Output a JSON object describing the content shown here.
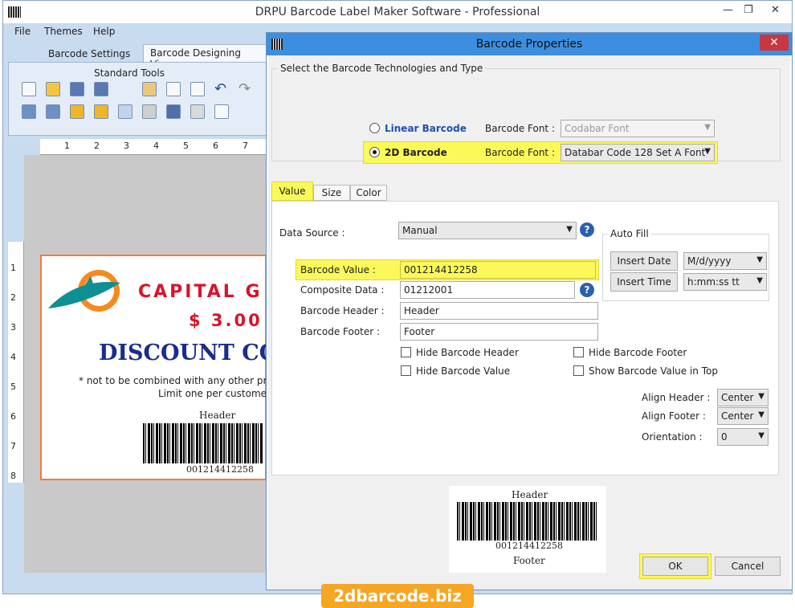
{
  "app": {
    "title": "DRPU Barcode Label Maker Software - Professional",
    "menu": [
      "File",
      "Themes",
      "Help"
    ],
    "ribbon_tabs": [
      "Barcode Settings",
      "Barcode Designing View"
    ],
    "ribbon_group": "Standard Tools",
    "ruler_h": [
      "1",
      "2",
      "3",
      "4",
      "5",
      "6",
      "7"
    ],
    "ruler_v": [
      "1",
      "2",
      "3",
      "4",
      "5",
      "6",
      "7",
      "8"
    ]
  },
  "label": {
    "line1": "CAPITAL G",
    "line2": "$ 3.00",
    "line3": "DISCOUNT CO",
    "fine1": "* not to be combined with any other pro",
    "fine2": "Limit one per customer",
    "header": "Header",
    "value": "001214412258"
  },
  "dialog": {
    "title": "Barcode Properties",
    "close": "✕",
    "tech_group": "Select the Barcode Technologies and Type",
    "linear": {
      "label": "Linear Barcode",
      "font_label": "Barcode Font :",
      "font": "Codabar Font"
    },
    "twod": {
      "label": "2D Barcode",
      "font_label": "Barcode Font :",
      "font": "Databar Code 128 Set A Font"
    },
    "tabs": [
      "Value",
      "Size",
      "Color"
    ],
    "data_source_label": "Data Source :",
    "data_source": "Manual",
    "barcode_value_label": "Barcode Value :",
    "barcode_value": "001214412258",
    "composite_label": "Composite Data :",
    "composite": "01212001",
    "header_label": "Barcode Header :",
    "header": "Header",
    "footer_label": "Barcode Footer :",
    "footer": "Footer",
    "checks": {
      "hide_header": "Hide Barcode Header",
      "hide_value": "Hide Barcode Value",
      "hide_footer": "Hide Barcode Footer",
      "show_top": "Show Barcode Value in Top"
    },
    "autofill": {
      "title": "Auto Fill",
      "insert_date": "Insert Date",
      "date_format": "M/d/yyyy",
      "insert_time": "Insert Time",
      "time_format": "h:mm:ss tt"
    },
    "align_header_label": "Align Header  :",
    "align_header": "Center",
    "align_footer_label": "Align Footer  :",
    "align_footer": "Center",
    "orientation_label": "Orientation  :",
    "orientation": "0",
    "preview": {
      "header": "Header",
      "value": "001214412258",
      "footer": "Footer"
    },
    "ok": "OK",
    "cancel": "Cancel",
    "help": "?"
  },
  "watermark": "2dbarcode.biz",
  "colors": {
    "accent": "#3d8ee0",
    "highlight": "#fbf95a",
    "label_red": "#d8132a",
    "label_blue": "#1a2c8c",
    "orange": "#f27b3c"
  }
}
